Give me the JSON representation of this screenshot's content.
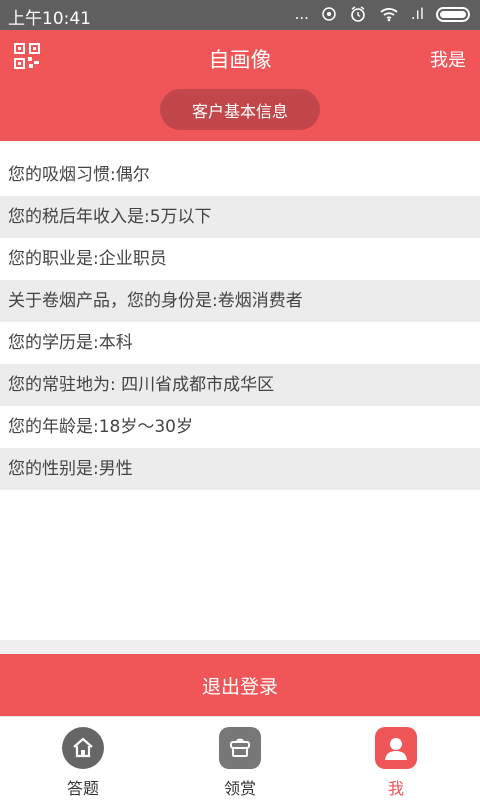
{
  "status_bar": {
    "time": "上午10:41",
    "dots": "...",
    "signal": ".ıl"
  },
  "header": {
    "title": "自画像",
    "right_link": "我是",
    "pill_label": "客户基本信息"
  },
  "info_rows": [
    "您的吸烟习惯:偶尔",
    "您的税后年收入是:5万以下",
    "您的职业是:企业职员",
    "关于卷烟产品，您的身份是:卷烟消费者",
    "您的学历是:本科",
    "您的常驻地为:  四川省成都市成华区",
    "您的年龄是:18岁～30岁",
    "您的性别是:男性"
  ],
  "logout_label": "退出登录",
  "tabs": {
    "home_label": "答题",
    "reward_label": "领赏",
    "me_label": "我"
  },
  "colors": {
    "accent": "#f05558",
    "pill": "#c2474a",
    "statusbar": "#5f5f5f"
  },
  "icons": [
    "qr-code-icon",
    "home-icon",
    "gift-box-icon",
    "user-icon",
    "wifi-icon",
    "alarm-icon",
    "battery-icon"
  ]
}
